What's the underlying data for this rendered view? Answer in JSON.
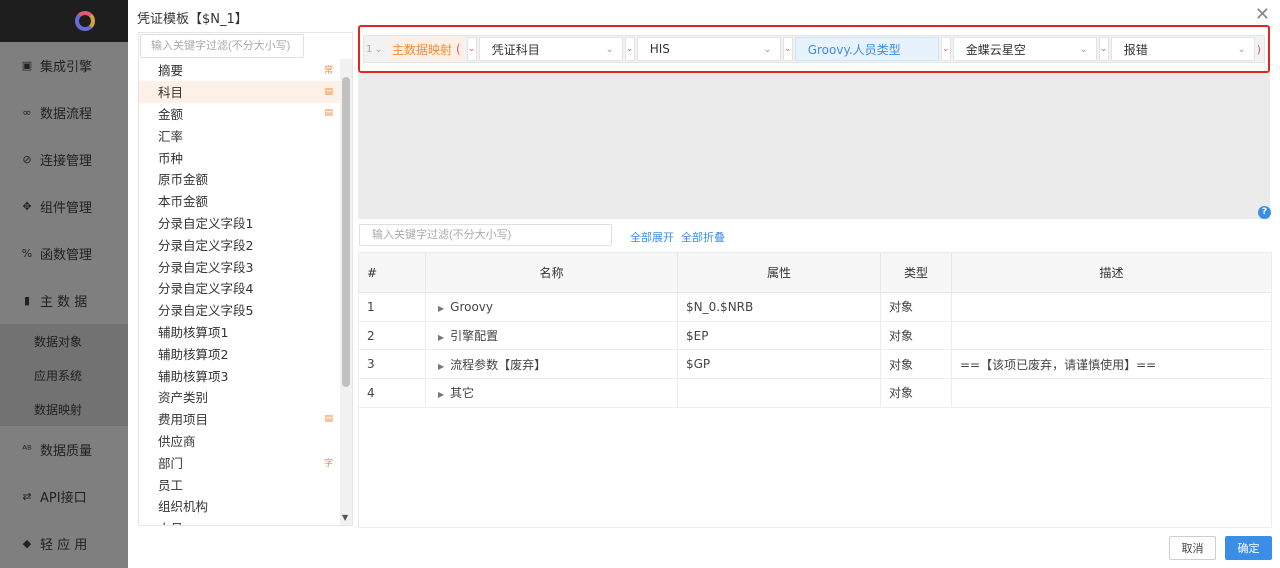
{
  "nav": {
    "items": [
      {
        "icon": "▣",
        "label": "集成引擎"
      },
      {
        "icon": "∞",
        "label": "数据流程"
      },
      {
        "icon": "⊘",
        "label": "连接管理"
      },
      {
        "icon": "✥",
        "label": "组件管理"
      },
      {
        "icon": "%",
        "label": "函数管理"
      },
      {
        "icon": "▮",
        "label": "主 数 据"
      }
    ],
    "subitems": [
      "数据对象",
      "应用系统",
      "数据映射"
    ],
    "items2": [
      {
        "icon": "ᴬᴮ",
        "label": "数据质量"
      },
      {
        "icon": "⇄",
        "label": "API接口"
      },
      {
        "icon": "◆",
        "label": "轻 应 用"
      }
    ]
  },
  "dialog": {
    "title": "凭证模板【$N_1】",
    "field_search_placeholder": "输入关键字过滤(不分大小写)",
    "fields": [
      {
        "label": "摘要",
        "tag": "常"
      },
      {
        "label": "科目",
        "tag": "▤"
      },
      {
        "label": "金额",
        "tag": "▤"
      },
      {
        "label": "汇率",
        "tag": ""
      },
      {
        "label": "币种",
        "tag": ""
      },
      {
        "label": "原币金额",
        "tag": ""
      },
      {
        "label": "本币金额",
        "tag": ""
      },
      {
        "label": "分录自定义字段1",
        "tag": ""
      },
      {
        "label": "分录自定义字段2",
        "tag": ""
      },
      {
        "label": "分录自定义字段3",
        "tag": ""
      },
      {
        "label": "分录自定义字段4",
        "tag": ""
      },
      {
        "label": "分录自定义字段5",
        "tag": ""
      },
      {
        "label": "辅助核算项1",
        "tag": ""
      },
      {
        "label": "辅助核算项2",
        "tag": ""
      },
      {
        "label": "辅助核算项3",
        "tag": ""
      },
      {
        "label": "资产类别",
        "tag": ""
      },
      {
        "label": "费用项目",
        "tag": "▤"
      },
      {
        "label": "供应商",
        "tag": ""
      },
      {
        "label": "部门",
        "tag": "字"
      },
      {
        "label": "员工",
        "tag": ""
      },
      {
        "label": "组织机构",
        "tag": ""
      },
      {
        "label": "人员",
        "tag": ""
      }
    ],
    "mapping": {
      "index": "1",
      "label": "主数据映射",
      "open_paren": "(",
      "close_paren": ")",
      "selects": [
        "凭证科目",
        "HIS",
        "Groovy.人员类型",
        "金蝶云星空",
        "报错"
      ]
    },
    "var_search_placeholder": "输入关键字过滤(不分大小写)",
    "expand_all": "全部展开",
    "collapse_all": "全部折叠",
    "table": {
      "headers": [
        "#",
        "名称",
        "属性",
        "类型",
        "描述"
      ],
      "rows": [
        {
          "idx": "1",
          "name": "Groovy",
          "prop": "$N_0.$NRB",
          "type": "对象",
          "desc": ""
        },
        {
          "idx": "2",
          "name": "引擎配置",
          "prop": "$EP",
          "type": "对象",
          "desc": ""
        },
        {
          "idx": "3",
          "name": "流程参数【废弃】",
          "prop": "$GP",
          "type": "对象",
          "desc": "==【该项已废弃，请谨慎使用】=="
        },
        {
          "idx": "4",
          "name": "其它",
          "prop": "",
          "type": "对象",
          "desc": ""
        }
      ]
    },
    "cancel": "取消",
    "ok": "确定",
    "help": "?"
  }
}
